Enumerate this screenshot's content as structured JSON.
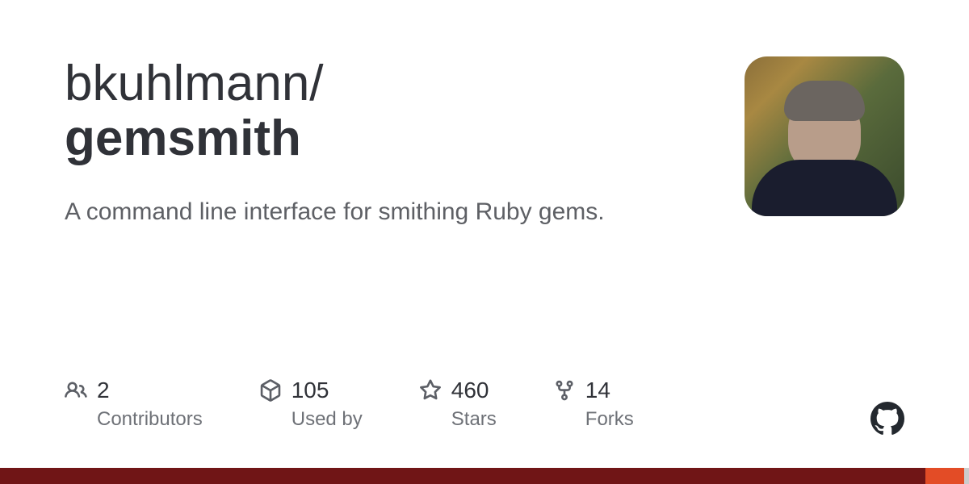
{
  "owner": "bkuhlmann/",
  "repo": "gemsmith",
  "description": "A command line interface for smithing Ruby gems.",
  "stats": {
    "contributors": {
      "value": "2",
      "label": "Contributors"
    },
    "usedby": {
      "value": "105",
      "label": "Used by"
    },
    "stars": {
      "value": "460",
      "label": "Stars"
    },
    "forks": {
      "value": "14",
      "label": "Forks"
    }
  }
}
